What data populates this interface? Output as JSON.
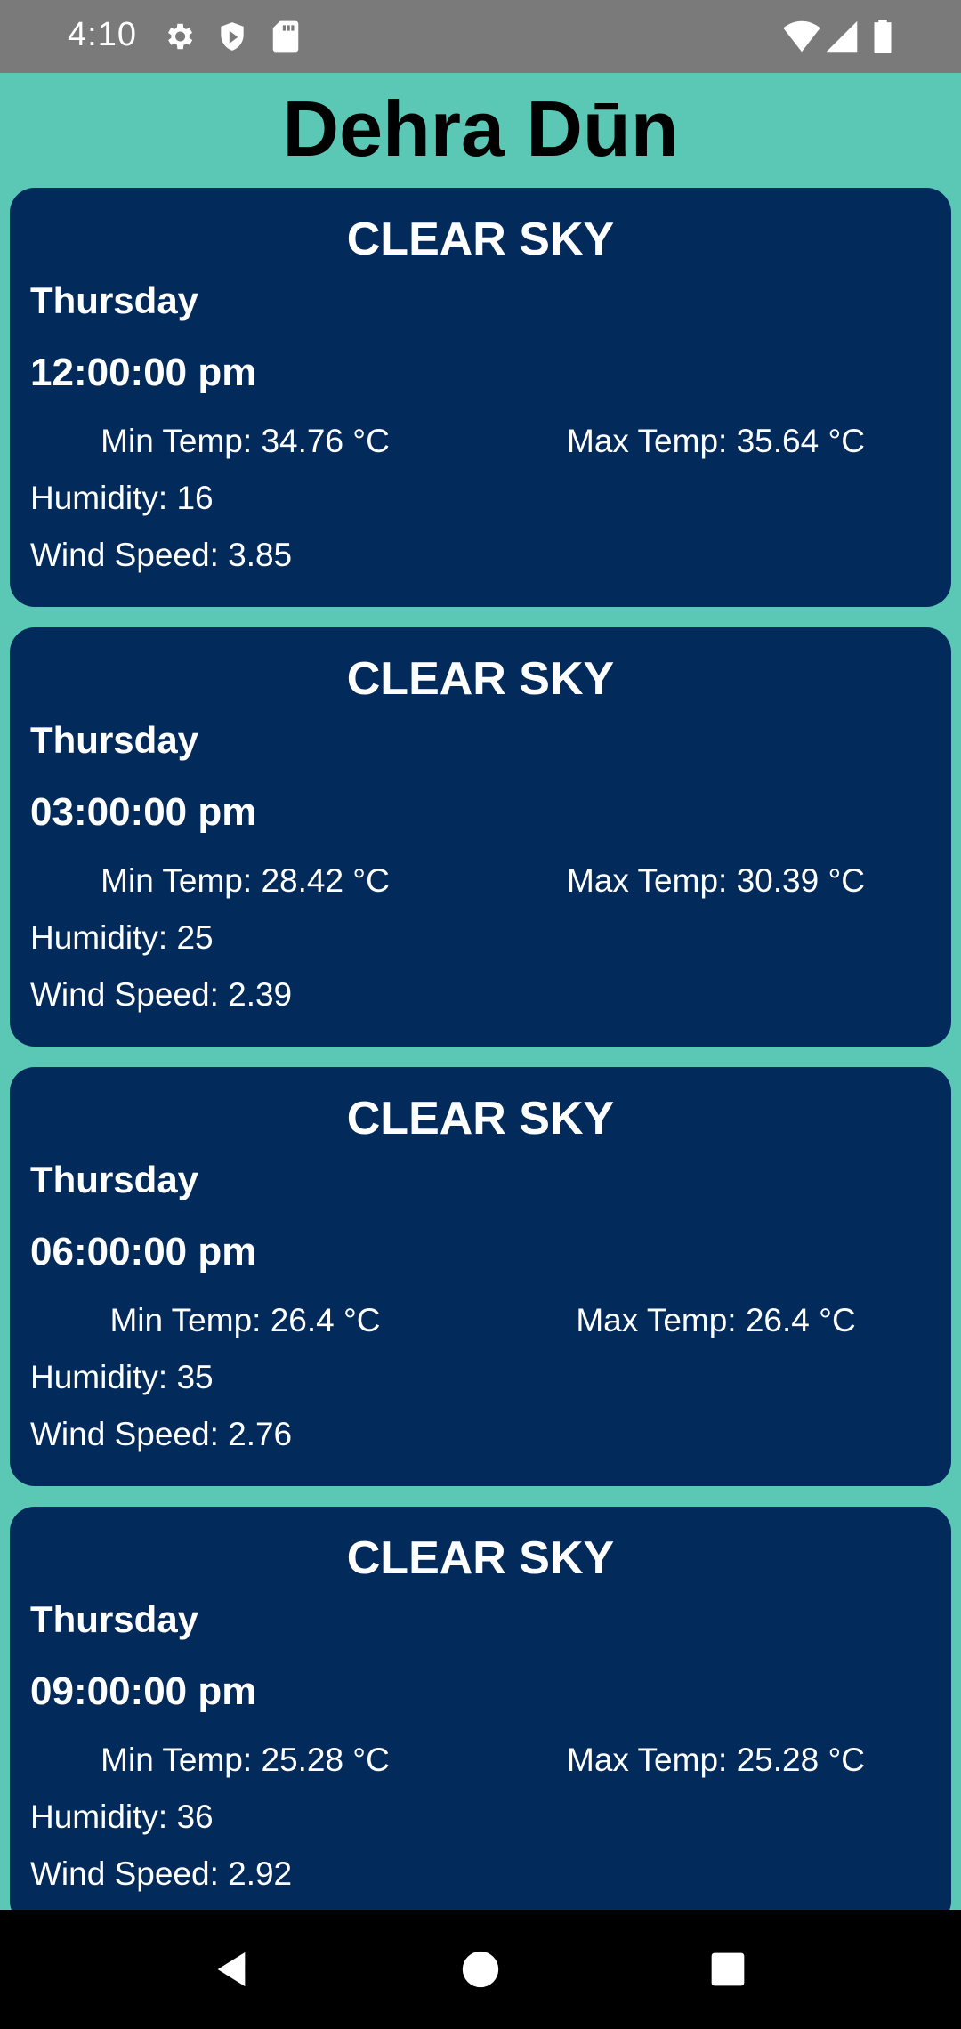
{
  "status_bar": {
    "time": "4:10",
    "icons": [
      "gear-icon",
      "shield-icon",
      "sd-card-icon",
      "wifi-icon",
      "signal-icon",
      "battery-icon"
    ]
  },
  "city": "Dehra Dūn",
  "forecasts": [
    {
      "condition": "CLEAR SKY",
      "day": "Thursday",
      "time": "12:00:00 pm",
      "min_temp": "Min Temp: 34.76 °C",
      "max_temp": "Max Temp: 35.64 °C",
      "humidity": "Humidity: 16",
      "wind_speed": "Wind Speed: 3.85"
    },
    {
      "condition": "CLEAR SKY",
      "day": "Thursday",
      "time": "03:00:00 pm",
      "min_temp": "Min Temp: 28.42 °C",
      "max_temp": "Max Temp: 30.39 °C",
      "humidity": "Humidity: 25",
      "wind_speed": "Wind Speed: 2.39"
    },
    {
      "condition": "CLEAR SKY",
      "day": "Thursday",
      "time": "06:00:00 pm",
      "min_temp": "Min Temp: 26.4 °C",
      "max_temp": "Max Temp: 26.4 °C",
      "humidity": "Humidity: 35",
      "wind_speed": "Wind Speed: 2.76"
    },
    {
      "condition": "CLEAR SKY",
      "day": "Thursday",
      "time": "09:00:00 pm",
      "min_temp": "Min Temp: 25.28 °C",
      "max_temp": "Max Temp: 25.28 °C",
      "humidity": "Humidity: 36",
      "wind_speed": "Wind Speed: 2.92"
    }
  ],
  "nav": [
    "back-icon",
    "home-icon",
    "recents-icon"
  ],
  "colors": {
    "background": "#5bc7b5",
    "card": "#022b5c",
    "status_bar": "#7a7a7a",
    "nav_bar": "#000000"
  }
}
